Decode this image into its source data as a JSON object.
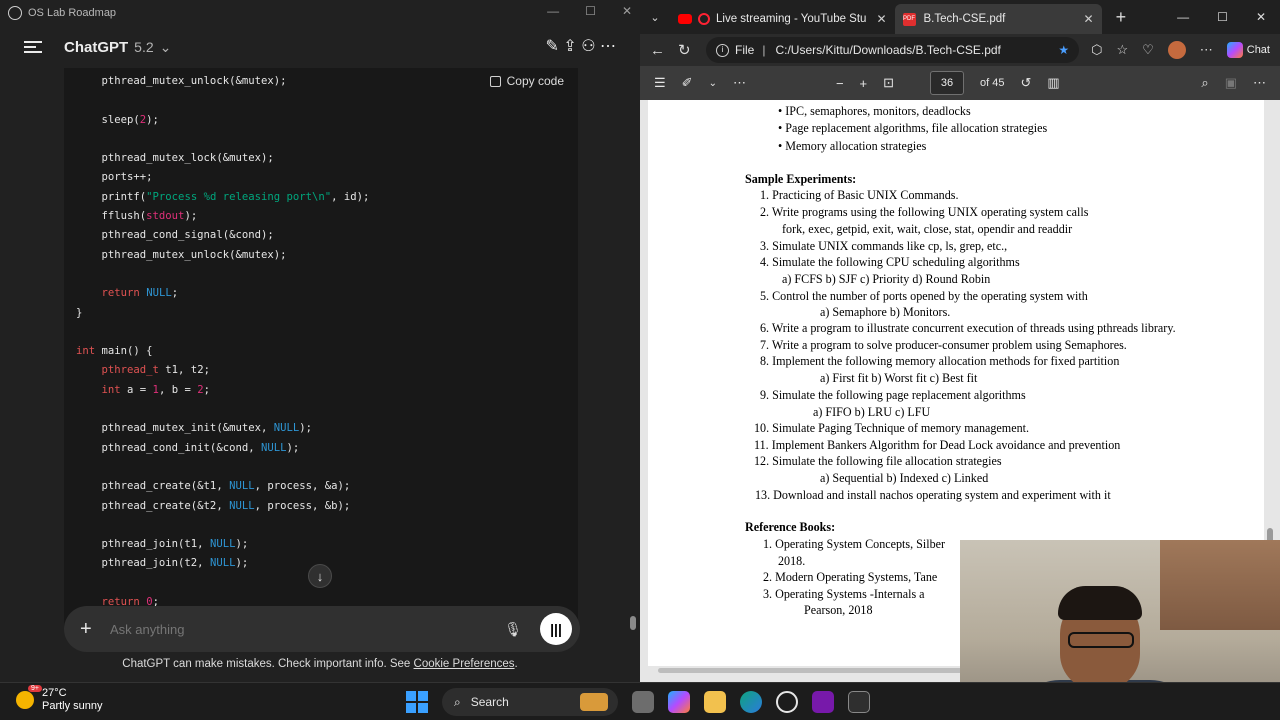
{
  "left": {
    "window_title": "OS Lab Roadmap",
    "model_name": "ChatGPT",
    "model_version": "5.2",
    "copy_label": "Copy code",
    "composer_placeholder": "Ask anything",
    "disclaimer": "ChatGPT can make mistakes. Check important info. See",
    "disclaimer_link": "Cookie Preferences",
    "disclaimer_end": ".",
    "code_lines": [
      "    pthread_mutex_unlock(&mutex);",
      "",
      "    sleep(2);",
      "",
      "    pthread_mutex_lock(&mutex);",
      "    ports++;",
      "    printf(\"Process %d releasing port\\n\", id);",
      "    fflush(stdout);",
      "    pthread_cond_signal(&cond);",
      "    pthread_mutex_unlock(&mutex);",
      "",
      "    return NULL;",
      "}",
      "",
      "int main() {",
      "    pthread_t t1, t2;",
      "    int a = 1, b = 2;",
      "",
      "    pthread_mutex_init(&mutex, NULL);",
      "    pthread_cond_init(&cond, NULL);",
      "",
      "    pthread_create(&t1, NULL, process, &a);",
      "    pthread_create(&t2, NULL, process, &b);",
      "",
      "    pthread_join(t1, NULL);",
      "    pthread_join(t2, NULL);",
      "",
      "    return 0;"
    ]
  },
  "right": {
    "tabs": [
      {
        "label": "Live streaming - YouTube Stu",
        "icon": "youtube-icon"
      },
      {
        "label": "B.Tech-CSE.pdf",
        "icon": "pdf-icon"
      }
    ],
    "address_prefix": "File",
    "address": "C:/Users/Kittu/Downloads/B.Tech-CSE.pdf",
    "chat_label": "Chat",
    "page_current": "36",
    "page_total": "of 45",
    "pdf_lines": [
      {
        "text": "•   IPC, semaphores, monitors, deadlocks",
        "indent": 0
      },
      {
        "text": "•   Page replacement algorithms, file allocation strategies",
        "indent": 0
      },
      {
        "text": "•   Memory allocation strategies",
        "indent": 0
      },
      {
        "text": "Sample Experiments:",
        "bold": true
      },
      {
        "text": "1.    Practicing of Basic UNIX Commands."
      },
      {
        "text": "2.    Write programs using the following UNIX operating system calls"
      },
      {
        "text": "fork, exec, getpid, exit, wait, close, stat, opendir and readdir"
      },
      {
        "text": "3.    Simulate UNIX commands like cp, ls, grep, etc.,"
      },
      {
        "text": "4.    Simulate the following CPU scheduling algorithms"
      },
      {
        "text": "a) FCFS b) SJF c) Priority d) Round Robin"
      },
      {
        "text": "5.    Control the number of ports opened by the operating system with"
      },
      {
        "text": "a) Semaphore b) Monitors."
      },
      {
        "text": "6.    Write a program to illustrate concurrent execution of threads using pthreads library."
      },
      {
        "text": "7.    Write a program to solve producer-consumer problem using Semaphores."
      },
      {
        "text": "8.    Implement the following memory allocation methods for fixed partition"
      },
      {
        "text": "a) First fit b) Worst fit c) Best fit"
      },
      {
        "text": "9.    Simulate the following page replacement algorithms"
      },
      {
        "text": "a) FIFO b) LRU c) LFU"
      },
      {
        "text": "10.   Simulate Paging Technique of memory management."
      },
      {
        "text": "11.   Implement Bankers Algorithm for Dead Lock avoidance and prevention"
      },
      {
        "text": "12.   Simulate the following file allocation strategies"
      },
      {
        "text": "a) Sequential b) Indexed c) Linked"
      },
      {
        "text": "13. Download and install nachos operating system and experiment with it"
      },
      {
        "text": "Reference Books:",
        "bold": true
      },
      {
        "text": "1.   Operating System Concepts, Silber"
      },
      {
        "text": "2018."
      },
      {
        "text": "2.    Modern Operating Systems, Tane"
      },
      {
        "text": "3.    Operating  Systems  -Internals  a"
      },
      {
        "text": "Pearson, 2018"
      }
    ]
  },
  "taskbar": {
    "temperature": "27°C",
    "weather": "Partly sunny",
    "weather_badge": "9+",
    "search_label": "Search"
  }
}
